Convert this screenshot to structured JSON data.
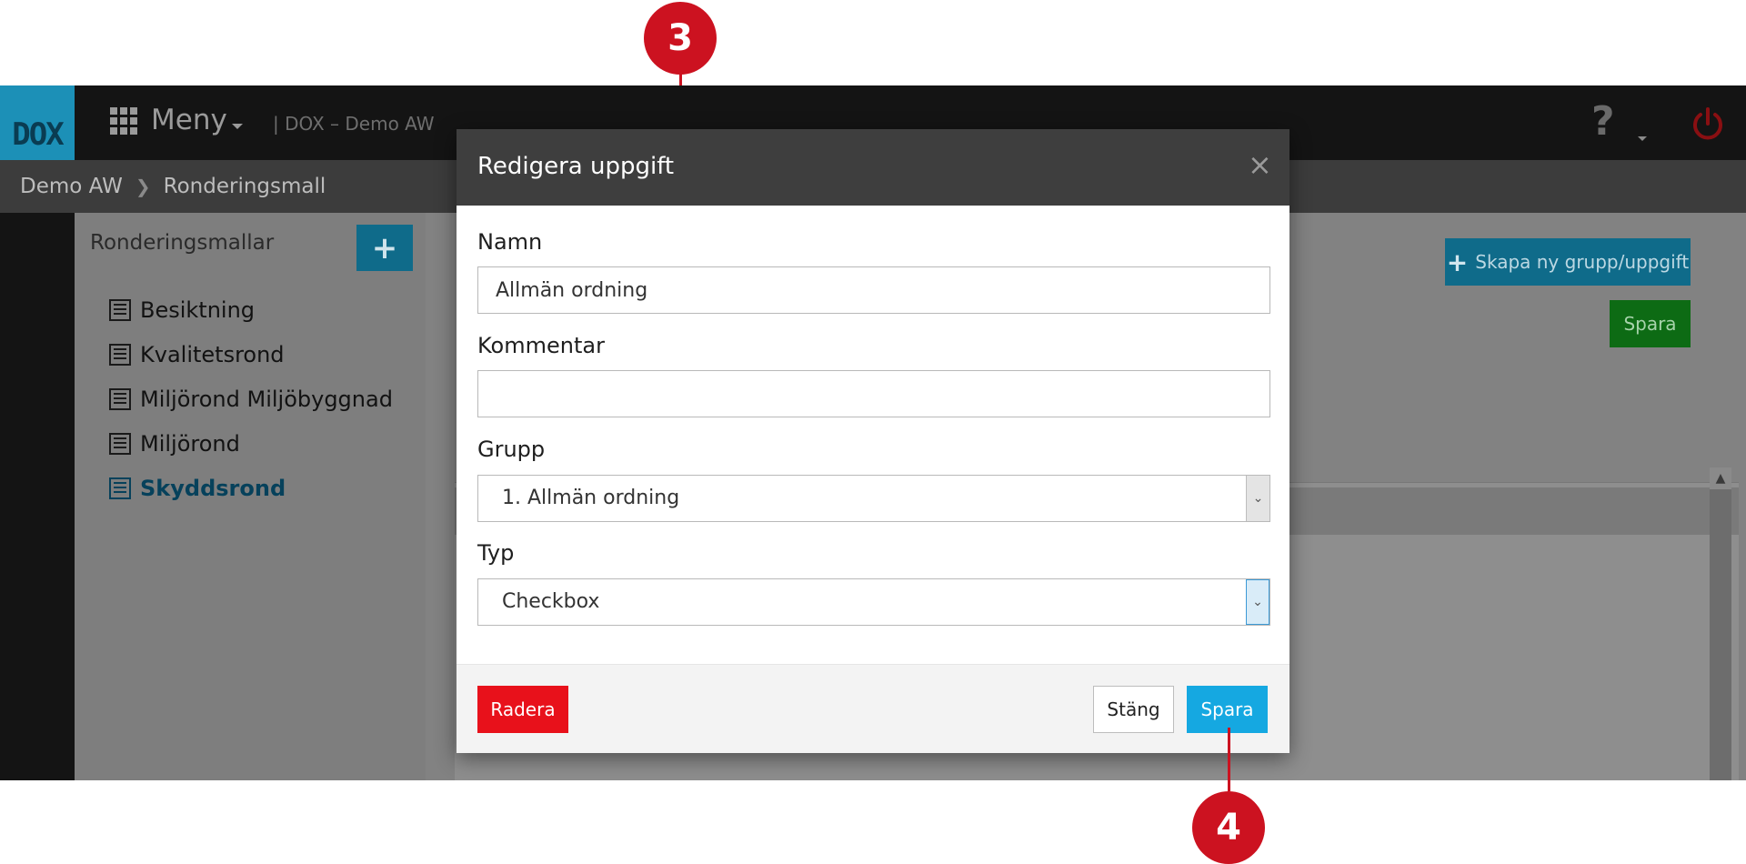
{
  "topbar": {
    "logo_text": "DOX",
    "menu_label": "Meny",
    "app_subtitle": "| DOX – Demo AW"
  },
  "breadcrumb": {
    "items": [
      "Demo AW",
      "Ronderingsmall"
    ]
  },
  "sidebar": {
    "title": "Ronderingsmallar",
    "add_label": "+",
    "items": [
      {
        "label": "Besiktning",
        "active": false
      },
      {
        "label": "Kvalitetsrond",
        "active": false
      },
      {
        "label": "Miljörond Miljöbyggnad",
        "active": false
      },
      {
        "label": "Miljörond",
        "active": false
      },
      {
        "label": "Skyddsrond",
        "active": true
      }
    ]
  },
  "main": {
    "create_label": "Skapa ny grupp/uppgift",
    "save_label": "Spara"
  },
  "modal": {
    "title": "Redigera uppgift",
    "close_glyph": "×",
    "name_label": "Namn",
    "name_value": "Allmän ordning",
    "comment_label": "Kommentar",
    "comment_value": "",
    "group_label": "Grupp",
    "group_value": "1. Allmän ordning",
    "type_label": "Typ",
    "type_value": "Checkbox",
    "delete_label": "Radera",
    "close_label": "Stäng",
    "save_label": "Spara"
  },
  "callouts": {
    "first": "3",
    "second": "4",
    "color": "#cc1220"
  },
  "colors": {
    "accent": "#15a8e1",
    "danger": "#e8111b",
    "success": "#0d6b14"
  }
}
